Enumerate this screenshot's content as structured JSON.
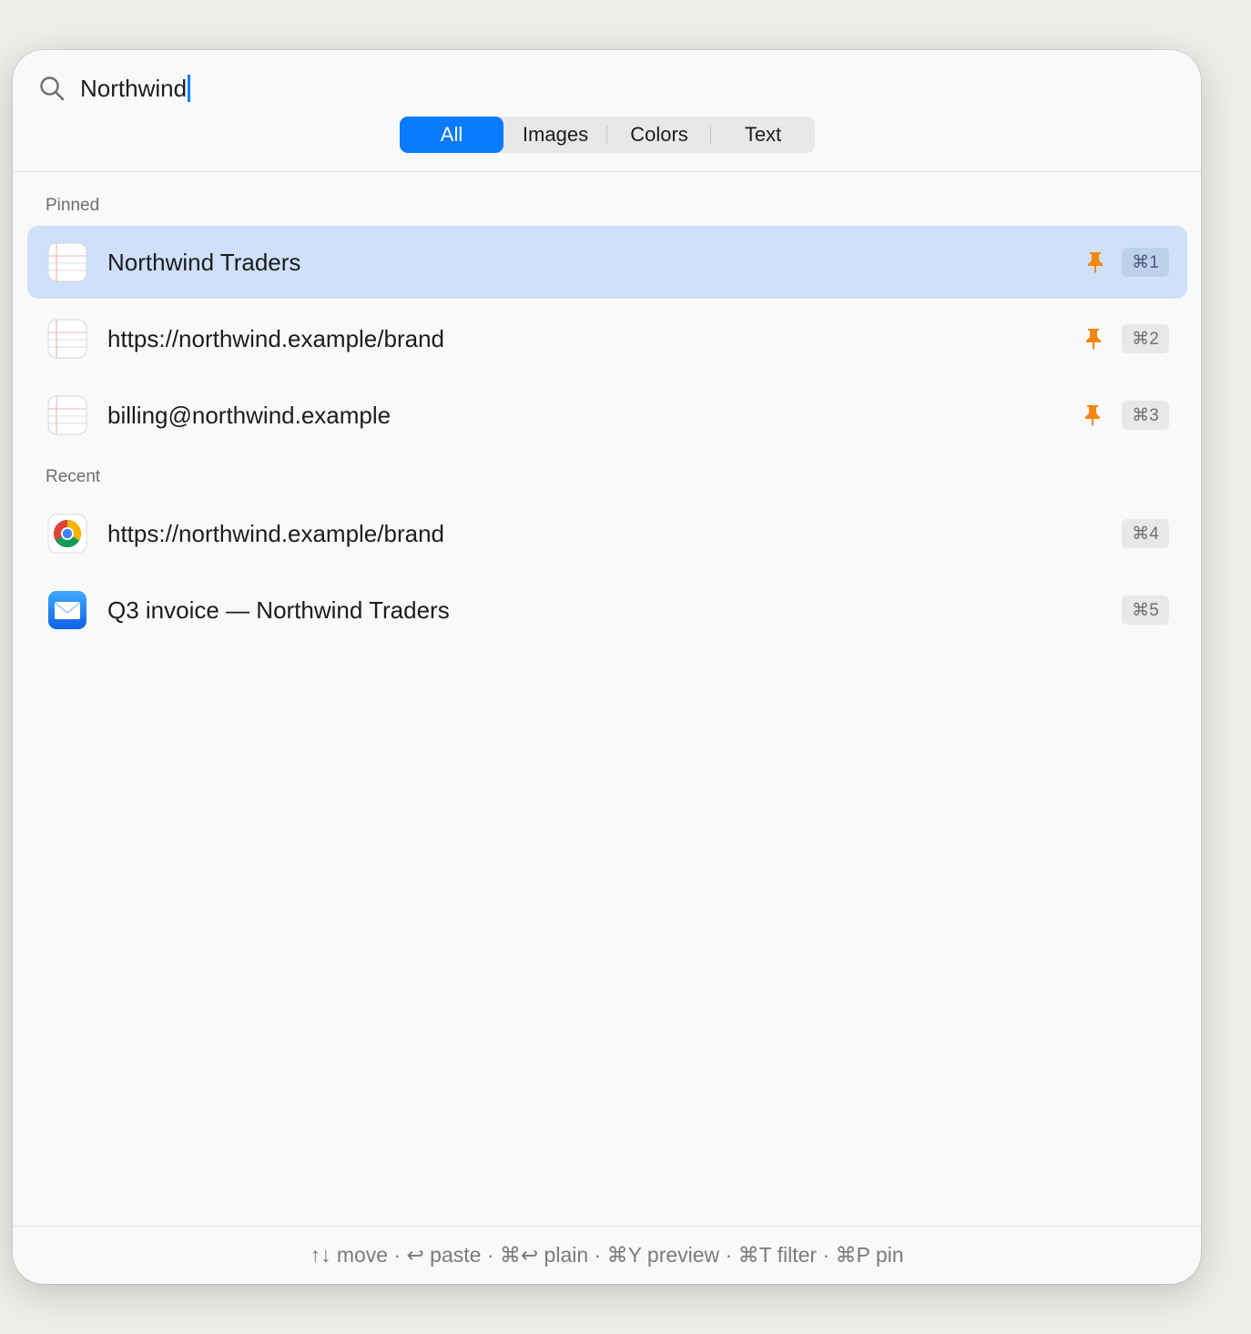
{
  "search": {
    "query": "Northwind",
    "icon": "magnifier-icon"
  },
  "filters": {
    "tabs": [
      "All",
      "Images",
      "Colors",
      "Text"
    ],
    "selected": "All"
  },
  "sections": {
    "pinned_label": "Pinned",
    "recent_label": "Recent"
  },
  "pinned": [
    {
      "label": "Northwind Traders",
      "icon": "notes-app-icon",
      "pinned": true,
      "shortcut": "⌘1",
      "selected": true
    },
    {
      "label": "https://northwind.example/brand",
      "icon": "notes-app-icon",
      "pinned": true,
      "shortcut": "⌘2",
      "selected": false
    },
    {
      "label": "billing@northwind.example",
      "icon": "notes-app-icon",
      "pinned": true,
      "shortcut": "⌘3",
      "selected": false
    }
  ],
  "recent": [
    {
      "label": "https://northwind.example/brand",
      "icon": "chrome-app-icon",
      "shortcut": "⌘4"
    },
    {
      "label": "Q3 invoice — Northwind Traders",
      "icon": "mail-app-icon",
      "shortcut": "⌘5"
    }
  ],
  "footer": {
    "hints": "↑↓ move · ↩ paste · ⌘↩ plain · ⌘Y preview · ⌘T filter · ⌘P pin"
  },
  "colors": {
    "accent": "#0a7aff",
    "selection": "#cfe0fa",
    "pin": "#f5860f"
  }
}
